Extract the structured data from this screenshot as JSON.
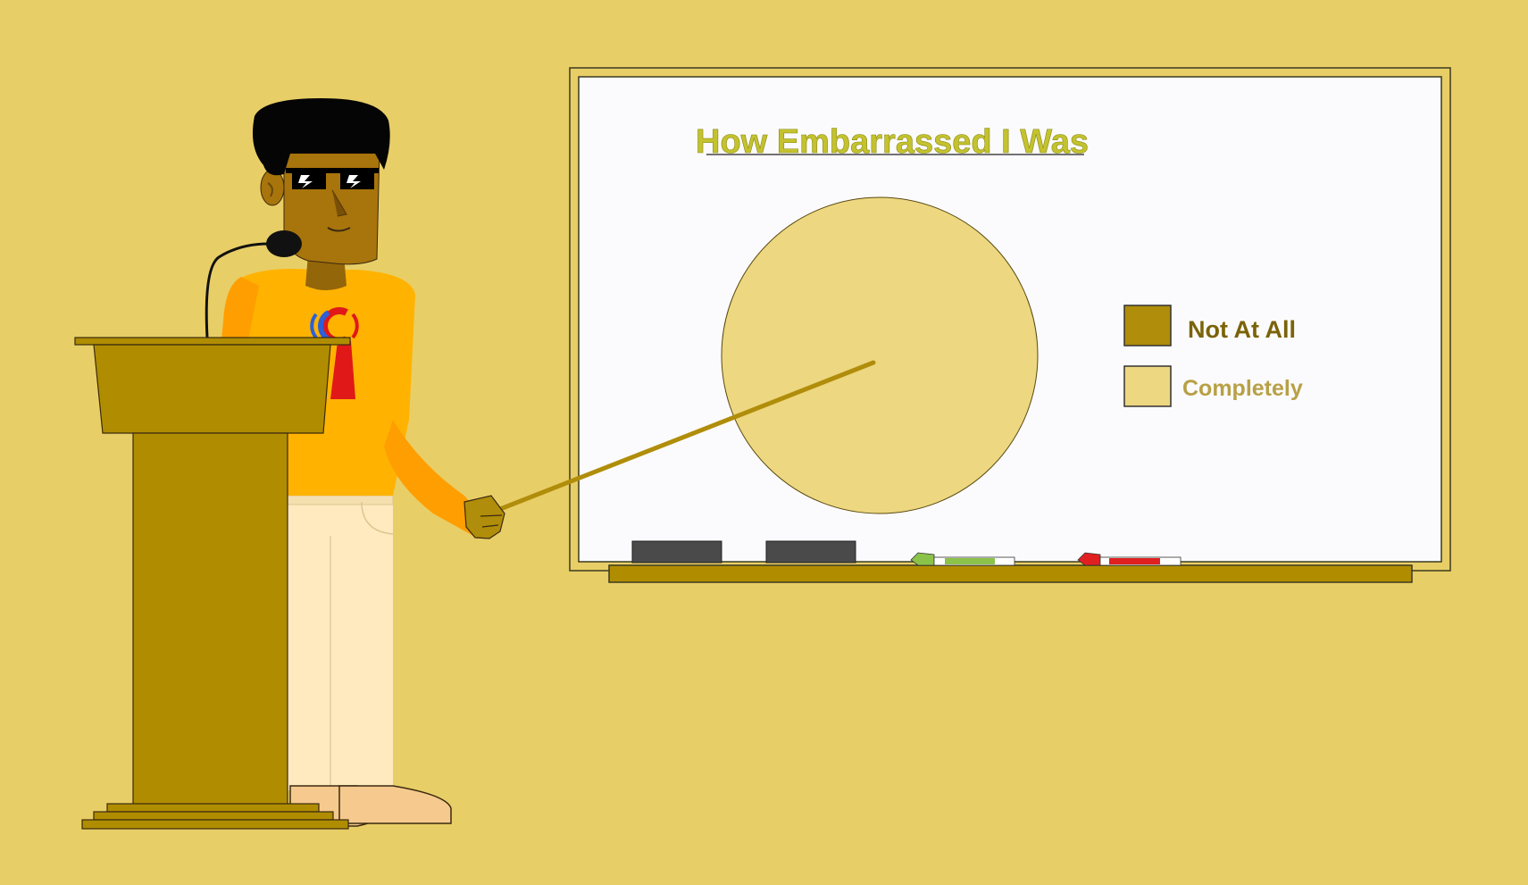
{
  "colors": {
    "background": "#E8CE66",
    "board_frame": "#E8CE66",
    "board_surface": "#FBFBFD",
    "title_color": "#C4C22E",
    "legend_dark": "#B08D0A",
    "legend_light": "#EDD780",
    "podium": "#B08D00",
    "shirt": "#FFB300",
    "skin": "#A8740C",
    "pants": "#FFEAC0"
  },
  "chart_data": {
    "type": "pie",
    "title": "How Embarrassed I Was",
    "slices": [
      {
        "label": "Not At All",
        "value": 0,
        "color": "#B08D0A"
      },
      {
        "label": "Completely",
        "value": 100,
        "color": "#EDD780"
      }
    ],
    "legend_position": "right"
  },
  "icons": {
    "shirt_logo": "c-logo-icon",
    "glasses": "pixel-sunglasses-icon",
    "microphone": "microphone-icon",
    "pointer": "pointer-stick-icon",
    "eraser": "eraser-icon",
    "marker_green": "green-marker-icon",
    "marker_red": "red-marker-icon"
  }
}
